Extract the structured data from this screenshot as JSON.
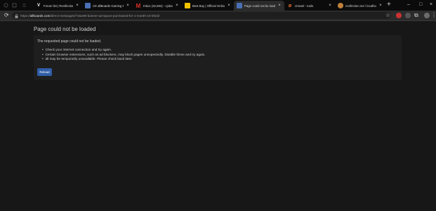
{
  "tabs": [
    {
      "label": "Forum list | Revifection",
      "favicon_color": "#ffffff",
      "favicon_glyph": "V",
      "active": false
    },
    {
      "label": "CE allBoards Gaming Fo",
      "favicon_color": "#4a6fb5",
      "favicon_glyph": "",
      "active": false
    },
    {
      "label": "Inbox (32,694) - cjoba...",
      "favicon_color": "#d93025",
      "favicon_glyph": "M",
      "active": false
    },
    {
      "label": "Best Buy | Official Online",
      "favicon_color": "#f2c200",
      "favicon_glyph": "",
      "active": false
    },
    {
      "label": "Page could not be loade",
      "favicon_color": "#4a6fb5",
      "favicon_glyph": "",
      "active": true
    },
    {
      "label": "cHanel - tools",
      "favicon_color": "#e06c2a",
      "favicon_glyph": "",
      "active": false
    },
    {
      "label": "revifection.net / localhost",
      "favicon_color": "#c0803a",
      "favicon_glyph": "",
      "active": false
    }
  ],
  "address_bar": {
    "url_prefix": "https://",
    "url_host": "allboards.com",
    "url_path": "/direct-messages/?2&x90-banner-ad-space-purchased-for-1-month-10-0023/"
  },
  "page": {
    "title": "Page could not be loaded",
    "lead": "The requested page could not be loaded.",
    "bullets": [
      "Check your internet connection and try again.",
      "Certain browser extensions, such as ad blockers, may block pages unexpectedly. Disable these and try again.",
      "all may be temporarily unavailable. Please check back later."
    ],
    "reload_label": "Reload"
  },
  "colors": {
    "accent": "#2f5da8",
    "background": "#171717",
    "panel": "#1e1e1e"
  }
}
